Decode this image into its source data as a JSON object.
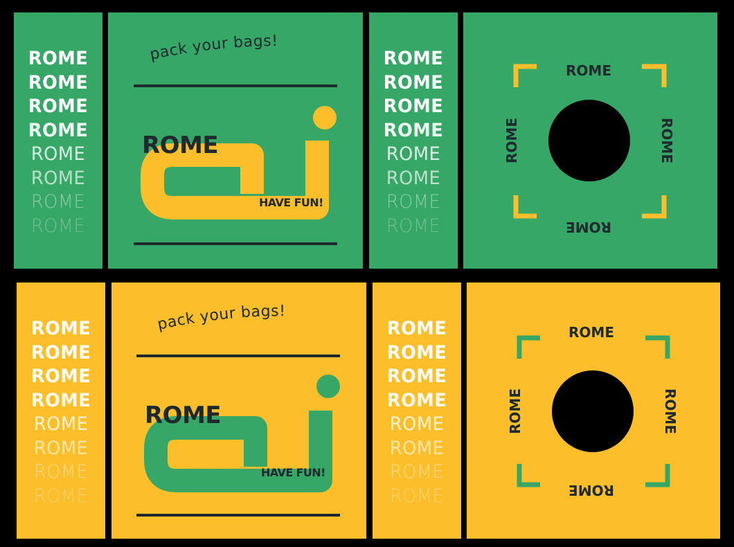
{
  "colors": {
    "green": "#36a766",
    "yellow": "#fcbf2b",
    "ink": "#1f2a2f",
    "black": "#000000",
    "white": "#ffffff"
  },
  "rows": [
    {
      "theme": "green",
      "accent": "yellow",
      "stack_words": [
        "ROME",
        "ROME",
        "ROME",
        "ROME",
        "ROME",
        "ROME",
        "ROME",
        "ROME"
      ],
      "poster": {
        "tagline": "pack your bags!",
        "title": "ROME",
        "subtitle": "HAVE FUN!"
      },
      "badge": {
        "top": "ROME",
        "bottom": "ROME",
        "left": "ROME",
        "right": "ROME"
      }
    },
    {
      "theme": "yellow",
      "accent": "green",
      "stack_words": [
        "ROME",
        "ROME",
        "ROME",
        "ROME",
        "ROME",
        "ROME",
        "ROME",
        "ROME"
      ],
      "poster": {
        "tagline": "pack your bags!",
        "title": "ROME",
        "subtitle": "HAVE FUN!"
      },
      "badge": {
        "top": "ROME",
        "bottom": "ROME",
        "left": "ROME",
        "right": "ROME"
      }
    }
  ]
}
